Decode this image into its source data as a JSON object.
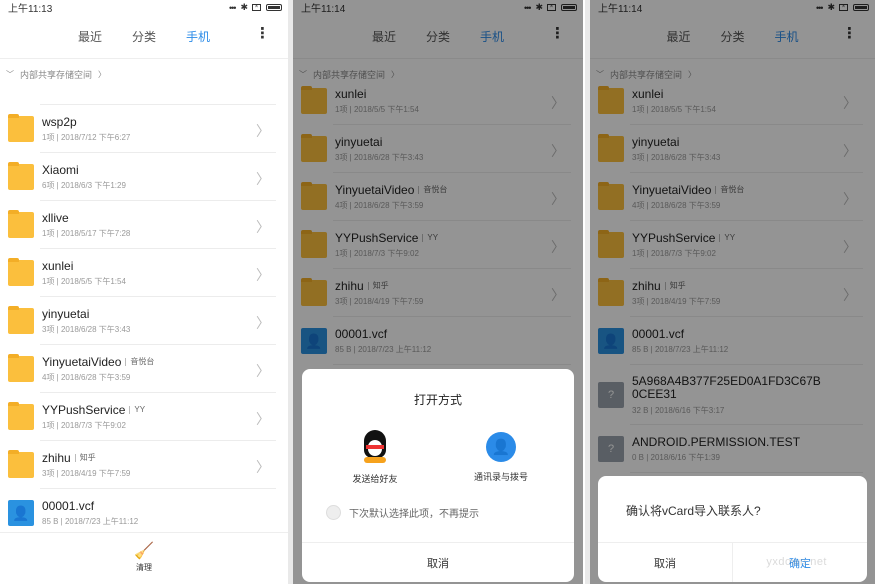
{
  "tabs": {
    "recent": "最近",
    "category": "分类",
    "phone": "手机"
  },
  "breadcrumb": "内部共享存储空间",
  "colors": {
    "accent": "#2b8be8",
    "folder": "#fbbf3d",
    "vcf_icon": "#2a92e0"
  },
  "screen1": {
    "time": "上午11:13",
    "items": [
      {
        "name": "wsp2p",
        "tag": "",
        "info": "1项 | 2018/7/12 下午6:27",
        "icon": "folder-icon"
      },
      {
        "name": "Xiaomi",
        "tag": "",
        "info": "6项 | 2018/6/3 下午1:29",
        "icon": "folder-icon"
      },
      {
        "name": "xllive",
        "tag": "",
        "info": "1项 | 2018/5/17 下午7:28",
        "icon": "folder-icon"
      },
      {
        "name": "xunlei",
        "tag": "",
        "info": "1项 | 2018/5/5 下午1:54",
        "icon": "folder-icon"
      },
      {
        "name": "yinyuetai",
        "tag": "",
        "info": "3项 | 2018/6/28 下午3:43",
        "icon": "folder-icon"
      },
      {
        "name": "YinyuetaiVideo",
        "tag": "音悦台",
        "info": "4项 | 2018/6/28 下午3:59",
        "icon": "folder-icon"
      },
      {
        "name": "YYPushService",
        "tag": "YY",
        "info": "1项 | 2018/7/3 下午9:02",
        "icon": "folder-icon"
      },
      {
        "name": "zhihu",
        "tag": "知乎",
        "info": "3项 | 2018/4/19 下午7:59",
        "icon": "folder-icon"
      },
      {
        "name": "00001.vcf",
        "tag": "",
        "info": "85 B | 2018/7/23 上午11:12",
        "icon": "vcf-icon"
      }
    ],
    "clean_label": "清理"
  },
  "screen2": {
    "time": "上午11:14",
    "items": [
      {
        "name": "xunlei",
        "tag": "",
        "info": "1项 | 2018/5/5 下午1:54",
        "icon": "folder-icon"
      },
      {
        "name": "yinyuetai",
        "tag": "",
        "info": "3项 | 2018/6/28 下午3:43",
        "icon": "folder-icon"
      },
      {
        "name": "YinyuetaiVideo",
        "tag": "音悦台",
        "info": "4项 | 2018/6/28 下午3:59",
        "icon": "folder-icon"
      },
      {
        "name": "YYPushService",
        "tag": "YY",
        "info": "1项 | 2018/7/3 下午9:02",
        "icon": "folder-icon"
      },
      {
        "name": "zhihu",
        "tag": "知乎",
        "info": "3项 | 2018/4/19 下午7:59",
        "icon": "folder-icon"
      },
      {
        "name": "00001.vcf",
        "tag": "",
        "info": "85 B | 2018/7/23 上午11:12",
        "icon": "vcf-icon"
      }
    ],
    "sheet": {
      "title": "打开方式",
      "app_qq": "发送给好友",
      "app_contacts": "通讯录与拨号",
      "remember": "下次默认选择此项，不再提示",
      "cancel": "取消"
    }
  },
  "screen3": {
    "time": "上午11:14",
    "items": [
      {
        "name": "xunlei",
        "tag": "",
        "info": "1项 | 2018/5/5 下午1:54",
        "icon": "folder-icon"
      },
      {
        "name": "yinyuetai",
        "tag": "",
        "info": "3项 | 2018/6/28 下午3:43",
        "icon": "folder-icon"
      },
      {
        "name": "YinyuetaiVideo",
        "tag": "音悦台",
        "info": "4项 | 2018/6/28 下午3:59",
        "icon": "folder-icon"
      },
      {
        "name": "YYPushService",
        "tag": "YY",
        "info": "1项 | 2018/7/3 下午9:02",
        "icon": "folder-icon"
      },
      {
        "name": "zhihu",
        "tag": "知乎",
        "info": "3项 | 2018/4/19 下午7:59",
        "icon": "folder-icon"
      },
      {
        "name": "00001.vcf",
        "tag": "",
        "info": "85 B | 2018/7/23 上午11:12",
        "icon": "vcf-icon"
      },
      {
        "name": "5A968A4B377F25ED0A1FD3C67B0CEE31",
        "tag": "",
        "info": "32 B | 2018/6/16 下午3:17",
        "icon": "unknown-file-icon"
      },
      {
        "name": "ANDROID.PERMISSION.TEST",
        "tag": "",
        "info": "0 B | 2018/6/16 下午1:39",
        "icon": "unknown-file-icon"
      }
    ],
    "dialog": {
      "message": "确认将vCard导入联系人?",
      "cancel": "取消",
      "confirm": "确定",
      "watermark": "yxdown.net"
    }
  }
}
